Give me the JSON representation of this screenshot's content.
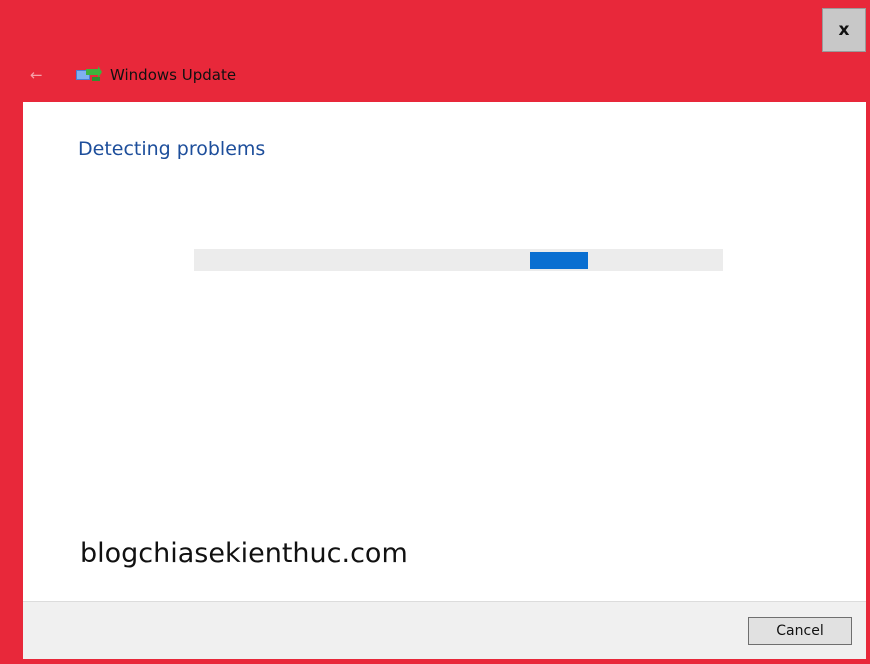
{
  "window": {
    "close_label": "x",
    "accent_color": "#e8283a"
  },
  "titlebar": {
    "back_icon": "back-arrow-icon",
    "app_icon": "windows-update-icon",
    "title": "Windows Update"
  },
  "main": {
    "heading": "Detecting problems",
    "progress": {
      "state": "indeterminate",
      "chunk_position_fraction": 0.635,
      "chunk_color": "#0a6fd1"
    },
    "watermark": "blogchiasekienthuc.com"
  },
  "footer": {
    "cancel_label": "Cancel"
  }
}
